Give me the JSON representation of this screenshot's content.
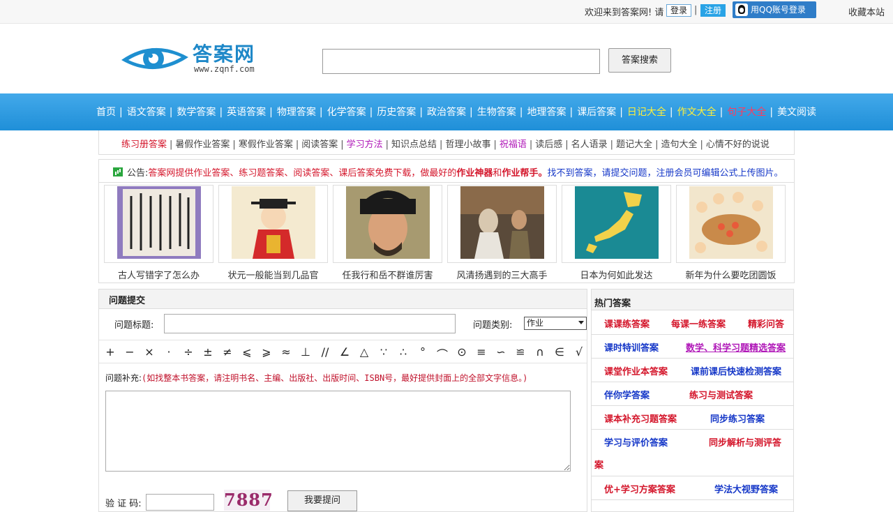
{
  "topbar": {
    "welcome": "欢迎来到答案网! 请",
    "login": "登录",
    "sep": "|",
    "register": "注册",
    "qq_login": "用QQ账号登录",
    "favorite": "收藏本站"
  },
  "logo": {
    "name": "答案网",
    "url": "www.zqnf.com"
  },
  "search": {
    "button": "答案搜索"
  },
  "nav": [
    {
      "label": "首页"
    },
    {
      "label": "语文答案"
    },
    {
      "label": "数学答案"
    },
    {
      "label": "英语答案"
    },
    {
      "label": "物理答案"
    },
    {
      "label": "化学答案"
    },
    {
      "label": "历史答案"
    },
    {
      "label": "政治答案"
    },
    {
      "label": "生物答案"
    },
    {
      "label": "地理答案"
    },
    {
      "label": "课后答案"
    },
    {
      "label": "日记大全"
    },
    {
      "label": "作文大全"
    },
    {
      "label": "句子大全"
    },
    {
      "label": "美文阅读"
    }
  ],
  "subnav": [
    {
      "label": "练习册答案"
    },
    {
      "label": "暑假作业答案"
    },
    {
      "label": "寒假作业答案"
    },
    {
      "label": "阅读答案"
    },
    {
      "label": "学习方法"
    },
    {
      "label": "知识点总结"
    },
    {
      "label": "哲理小故事"
    },
    {
      "label": "祝福语"
    },
    {
      "label": "读后感"
    },
    {
      "label": "名人语录"
    },
    {
      "label": "题记大全"
    },
    {
      "label": "造句大全"
    },
    {
      "label": "心情不好的说说"
    }
  ],
  "notice": {
    "label": "公告:",
    "part1": "答案网提供作业答案、练习题答案、阅读答案、课后答案免费下载，做最好的",
    "bold1": "作业神器",
    "and": "和",
    "bold2": "作业帮手。",
    "part2": "找不到答案，请提交问题，注册会员可编辑公式上传图片。"
  },
  "gallery": [
    {
      "caption": "古人写错字了怎么办"
    },
    {
      "caption": "状元一般能当到几品官"
    },
    {
      "caption": "任我行和岳不群谁厉害"
    },
    {
      "caption": "风清扬遇到的三大高手"
    },
    {
      "caption": "日本为何如此发达"
    },
    {
      "caption": "新年为什么要吃团圆饭"
    }
  ],
  "question": {
    "header": "问题提交",
    "title_label": "问题标题:",
    "category_label": "问题类别:",
    "category_value": "作业",
    "symbols": [
      "+",
      "−",
      "×",
      "·",
      "÷",
      "±",
      "≠",
      "⩽",
      "⩾",
      "≈",
      "⊥",
      "//",
      "∠",
      "△",
      "∵",
      "∴",
      "°",
      "⌒",
      "⊙",
      "≡",
      "∽",
      "≌",
      "∩",
      "∈",
      "√"
    ],
    "supp_label": "问题补充:",
    "supp_hint": "(如找整本书答案，请注明书名、主编、出版社、出版时间、ISBN号，最好提供封面上的全部文字信息。)",
    "captcha_label": "验 证 码:",
    "captcha_code": "7887",
    "submit": "我要提问"
  },
  "hot": {
    "header": "热门答案",
    "rows": [
      [
        {
          "label": "课课练答案",
          "color": "red"
        },
        {
          "label": "每课一练答案",
          "color": "red"
        },
        {
          "label": "精彩问答",
          "color": "red"
        }
      ],
      [
        {
          "label": "课时特训答案",
          "color": "blue"
        },
        {
          "label": "数学、科学习题精选答案",
          "color": "purple"
        }
      ],
      [
        {
          "label": "课堂作业本答案",
          "color": "red"
        },
        {
          "label": "课前课后快速检测答案",
          "color": "blue"
        }
      ],
      [
        {
          "label": "伴你学答案",
          "color": "blue"
        },
        {
          "label": "练习与测试答案",
          "color": "red"
        }
      ],
      [
        {
          "label": "课本补充习题答案",
          "color": "red"
        },
        {
          "label": "同步练习答案",
          "color": "blue"
        }
      ],
      [
        {
          "label": "学习与评价答案",
          "color": "blue"
        },
        {
          "label": "同步解析与测评答",
          "color": "red"
        },
        {
          "label": "案",
          "color": "red"
        }
      ],
      [
        {
          "label": "优+学习方案答案",
          "color": "red"
        },
        {
          "label": "学法大视野答案",
          "color": "blue"
        }
      ]
    ]
  },
  "colors": {
    "nav_blue": "#2b9ae0",
    "accent_red": "#d4162b",
    "accent_blue": "#1638c8",
    "purple": "#b018b8"
  }
}
